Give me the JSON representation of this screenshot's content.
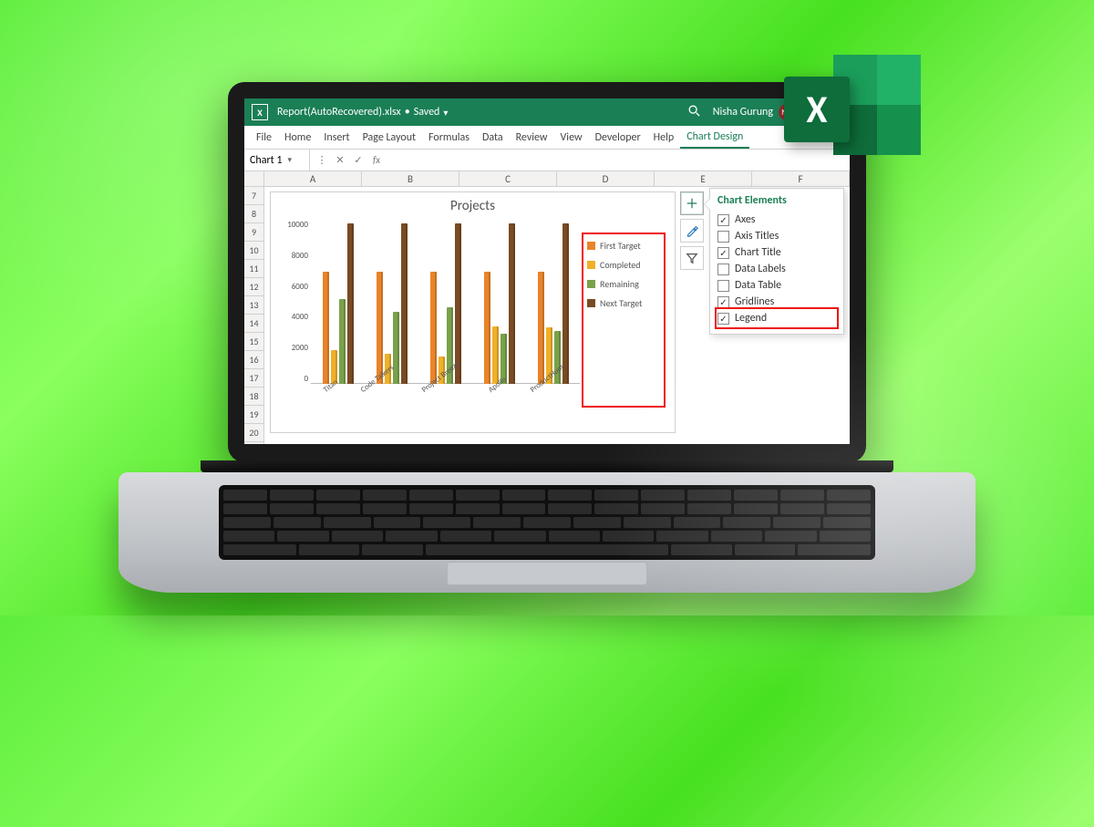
{
  "titlebar": {
    "app_glyph": "X",
    "filename": "Report(AutoRecovered).xlsx",
    "save_state": "Saved",
    "user_name": "Nisha Gurung",
    "user_initials": "NG"
  },
  "ribbon": {
    "tabs": [
      "File",
      "Home",
      "Insert",
      "Page Layout",
      "Formulas",
      "Data",
      "Review",
      "View",
      "Developer",
      "Help",
      "Chart Design"
    ],
    "active_tab": "Chart Design"
  },
  "namebox": {
    "value": "Chart 1"
  },
  "fx": {
    "cancel": "✕",
    "confirm": "✓",
    "label": "fx"
  },
  "columns": [
    "A",
    "B",
    "C",
    "D",
    "E",
    "F"
  ],
  "rows": [
    "7",
    "8",
    "9",
    "10",
    "11",
    "12",
    "13",
    "14",
    "15",
    "16",
    "17",
    "18",
    "19",
    "20"
  ],
  "chart_elements": {
    "title": "Chart Elements",
    "items": [
      {
        "label": "Axes",
        "checked": true,
        "highlight": false
      },
      {
        "label": "Axis Titles",
        "checked": false,
        "highlight": false
      },
      {
        "label": "Chart Title",
        "checked": true,
        "highlight": false
      },
      {
        "label": "Data Labels",
        "checked": false,
        "highlight": false
      },
      {
        "label": "Data Table",
        "checked": false,
        "highlight": false
      },
      {
        "label": "Gridlines",
        "checked": true,
        "highlight": false
      },
      {
        "label": "Legend",
        "checked": true,
        "highlight": true
      }
    ]
  },
  "side_buttons": {
    "plus": "plus-icon",
    "brush": "brush-icon",
    "funnel": "funnel-icon"
  },
  "chart_data": {
    "type": "bar",
    "title": "Projects",
    "ylabel": "",
    "xlabel": "",
    "ylim": [
      0,
      10000
    ],
    "y_ticks": [
      "10000",
      "8000",
      "6000",
      "4000",
      "2000",
      "0"
    ],
    "categories": [
      "Titan",
      "Code Talkers",
      "Project Breeze",
      "Apollo",
      "ProductHunt"
    ],
    "series": [
      {
        "name": "First Target",
        "color": "#e8842a",
        "values": [
          7000,
          7000,
          7000,
          7000,
          7000
        ]
      },
      {
        "name": "Completed",
        "color": "#f0b028",
        "values": [
          2100,
          1900,
          1700,
          3600,
          3500
        ]
      },
      {
        "name": "Remaining",
        "color": "#79a14a",
        "values": [
          5300,
          4500,
          4800,
          3100,
          3300
        ]
      },
      {
        "name": "Next Target",
        "color": "#7a4b23",
        "values": [
          10000,
          10000,
          10000,
          10000,
          10000
        ]
      }
    ],
    "legend_position": "right"
  },
  "excel_badge": {
    "glyph": "X"
  }
}
